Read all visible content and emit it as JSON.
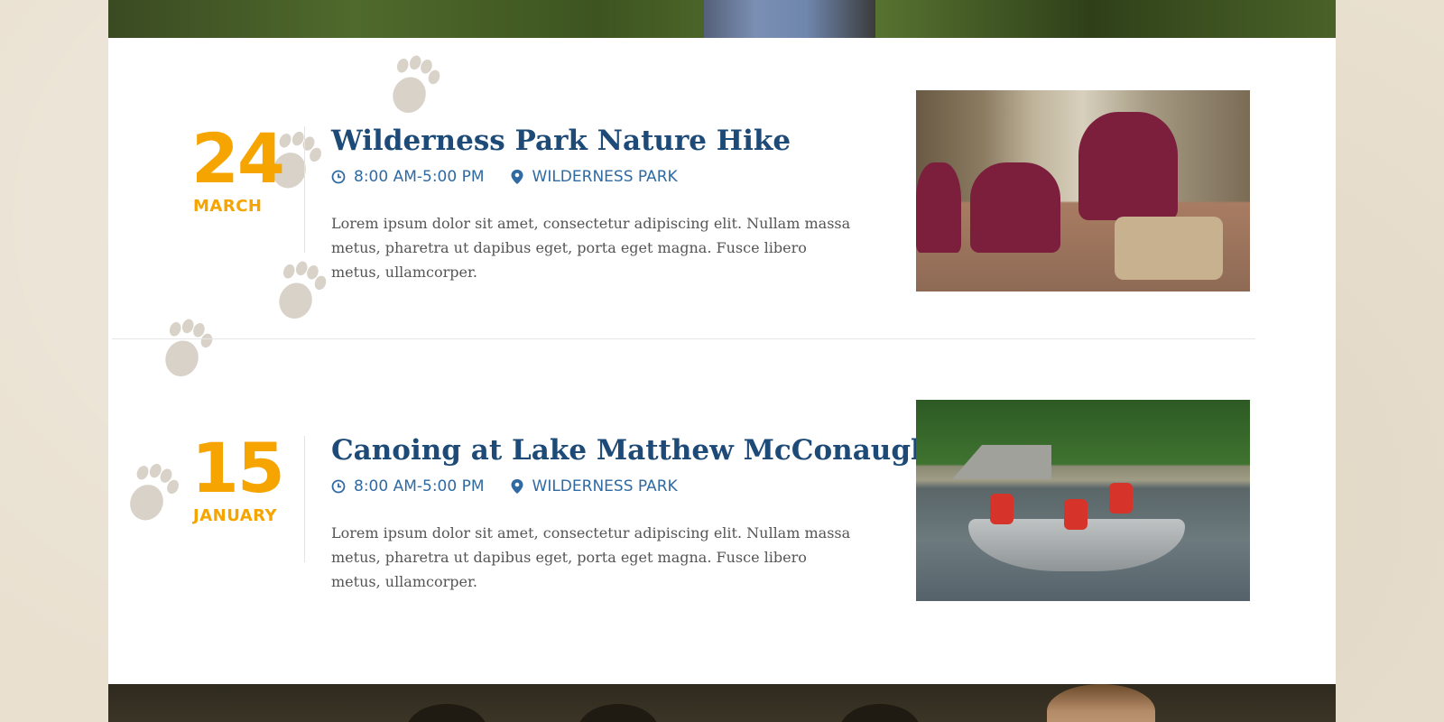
{
  "events": [
    {
      "day": "24",
      "month": "MARCH",
      "title": "Wilderness Park Nature Hike",
      "time": "8:00 AM-5:00 PM",
      "location": "WILDERNESS PARK",
      "description": "Lorem ipsum dolor sit amet, consectetur adipiscing elit. Nullam massa metus, pharetra ut dapibus eget, porta eget magna. Fusce libero metus, ullamcorper."
    },
    {
      "day": "15",
      "month": "JANUARY",
      "title": "Canoing at Lake Matthew McConaughy",
      "time": "8:00 AM-5:00 PM",
      "location": "WILDERNESS PARK",
      "description": "Lorem ipsum dolor sit amet, consectetur adipiscing elit. Nullam massa metus, pharetra ut dapibus eget, porta eget magna. Fusce libero metus, ullamcorper."
    }
  ],
  "icons": {
    "time": "clock-icon",
    "location": "map-pin-icon",
    "decoration": "paw-print-icon"
  },
  "colors": {
    "accent": "#f5a400",
    "title": "#1d4a76",
    "meta": "#2f6aa3",
    "body": "#555555",
    "background": "#e9e0d0"
  }
}
